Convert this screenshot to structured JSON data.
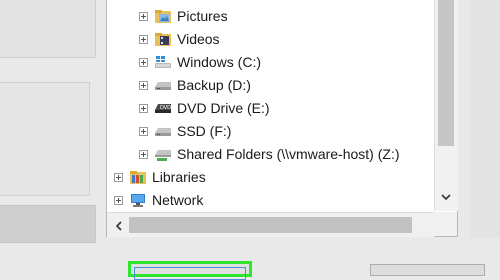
{
  "tree": {
    "items": [
      {
        "label": "Pictures",
        "icon": "pictures-folder-icon"
      },
      {
        "label": "Videos",
        "icon": "videos-folder-icon"
      },
      {
        "label": "Windows (C:)",
        "icon": "windows-drive-icon"
      },
      {
        "label": "Backup (D:)",
        "icon": "hard-drive-icon"
      },
      {
        "label": "DVD Drive (E:)",
        "icon": "dvd-drive-icon"
      },
      {
        "label": "SSD (F:)",
        "icon": "hard-drive-icon"
      },
      {
        "label": "Shared Folders (\\\\vmware-host) (Z:)",
        "icon": "network-drive-icon"
      },
      {
        "label": "Libraries",
        "icon": "libraries-icon"
      },
      {
        "label": "Network",
        "icon": "network-icon"
      }
    ]
  },
  "colors": {
    "highlight_border": "#2ee62e",
    "folder_yellow": "#e8c15a",
    "windows_blue": "#2f8fd8"
  }
}
